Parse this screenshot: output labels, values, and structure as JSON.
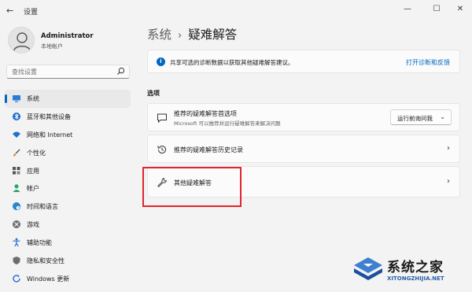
{
  "window": {
    "app_title": "设置",
    "back_glyph": "←",
    "minimize_glyph": "—",
    "maximize_glyph": "☐",
    "close_glyph": "✕"
  },
  "profile": {
    "name": "Administrator",
    "account_type": "本地帐户"
  },
  "search": {
    "placeholder": "查找设置"
  },
  "nav": {
    "items": [
      {
        "label": "系统",
        "icon": "monitor-icon",
        "active": true
      },
      {
        "label": "蓝牙和其他设备",
        "icon": "bluetooth-icon"
      },
      {
        "label": "网络和 Internet",
        "icon": "wifi-icon"
      },
      {
        "label": "个性化",
        "icon": "brush-icon"
      },
      {
        "label": "应用",
        "icon": "apps-icon"
      },
      {
        "label": "帐户",
        "icon": "person-icon"
      },
      {
        "label": "时间和语言",
        "icon": "globe-clock-icon"
      },
      {
        "label": "游戏",
        "icon": "xbox-icon"
      },
      {
        "label": "辅助功能",
        "icon": "accessibility-icon"
      },
      {
        "label": "隐私和安全性",
        "icon": "shield-icon"
      },
      {
        "label": "Windows 更新",
        "icon": "update-icon"
      }
    ]
  },
  "breadcrumb": {
    "parent": "系统",
    "separator": "›",
    "current": "疑难解答"
  },
  "banner": {
    "text": "共享可选的诊断数据以获取其他疑难解答建议。",
    "link": "打开诊断和反馈"
  },
  "section": {
    "title": "选项"
  },
  "cards": {
    "preferences": {
      "title": "推荐的疑难解答首选项",
      "subtitle": "Microsoft 可以推荐并运行疑难解答来解决问题",
      "select_value": "运行前询问我",
      "caret": "⌄"
    },
    "history": {
      "title": "推荐的疑难解答历史记录",
      "chevron": "›"
    },
    "other": {
      "title": "其他疑难解答",
      "chevron": "›"
    }
  },
  "watermark": {
    "title": "系统之家",
    "url": "XITONGZHIJIA.NET"
  },
  "colors": {
    "accent": "#0067c0",
    "highlight": "#e0262b",
    "background": "#f3f3f3"
  }
}
